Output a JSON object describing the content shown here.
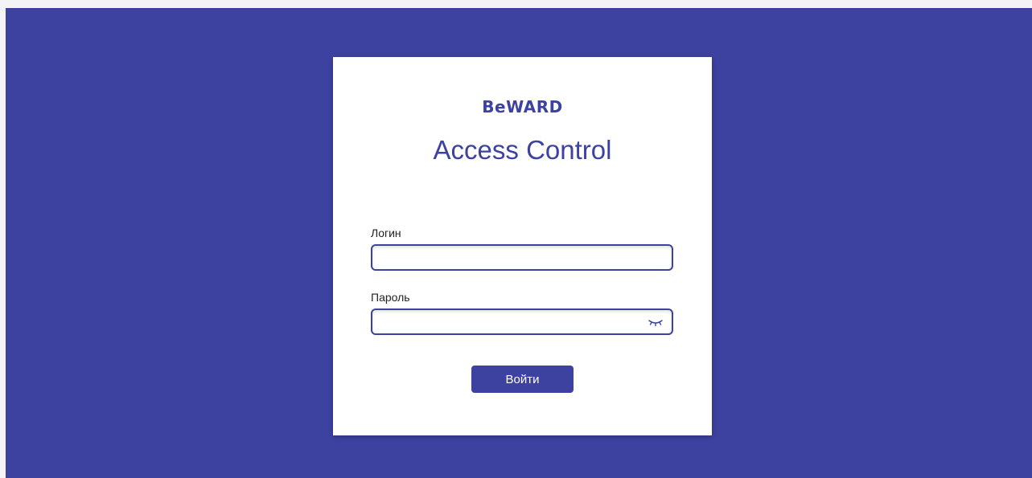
{
  "brand": {
    "logo_text": "BeWARD",
    "app_title": "Access Control"
  },
  "form": {
    "login_label": "Логин",
    "login_value": "",
    "login_placeholder": "",
    "password_label": "Пароль",
    "password_value": "",
    "password_placeholder": "",
    "password_toggle_icon": "eye-closed-icon",
    "submit_label": "Войти"
  },
  "colors": {
    "accent": "#3d42a0",
    "card_background": "#ffffff",
    "label_text": "#222222"
  }
}
